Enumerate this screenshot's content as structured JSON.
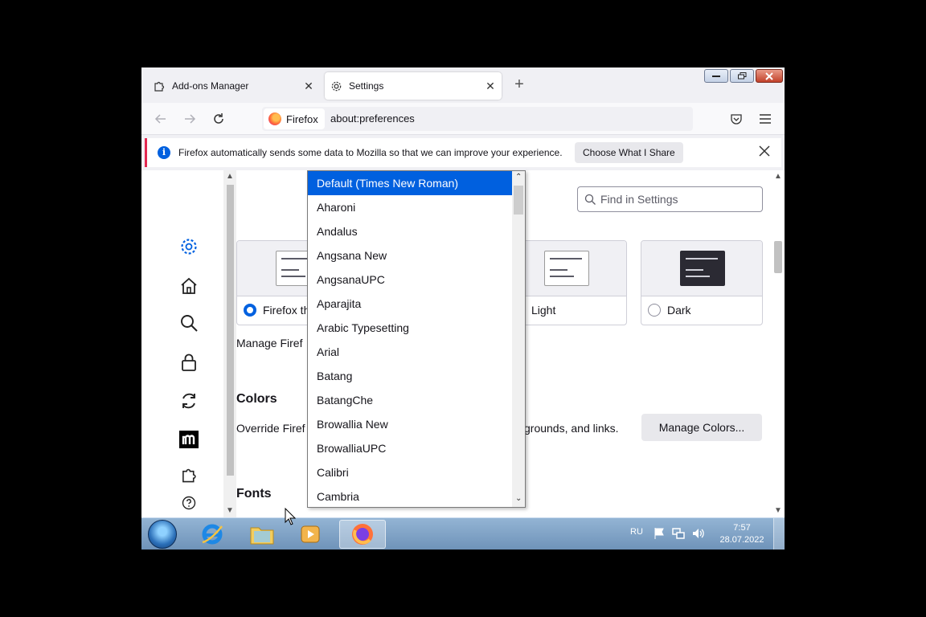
{
  "tabs": [
    {
      "title": "Add-ons Manager",
      "icon": "puzzle-icon"
    },
    {
      "title": "Settings",
      "icon": "gear-icon"
    }
  ],
  "navbar": {
    "identity_label": "Firefox",
    "url": "about:preferences"
  },
  "notification": {
    "text": "Firefox automatically sends some data to Mozilla so that we can improve your experience.",
    "button_label": "Choose What I Share"
  },
  "sidebar": {
    "categories": [
      "gear-icon",
      "home-icon",
      "search-icon",
      "lock-icon",
      "sync-icon",
      "mozilla-m-icon",
      "puzzle-icon",
      "help-icon"
    ]
  },
  "settings": {
    "search_placeholder": "Find in Settings",
    "themes": [
      {
        "label": "Firefox th",
        "checked": true
      },
      {
        "label": "Light",
        "checked": false
      },
      {
        "label": "Dark",
        "checked": false
      }
    ],
    "manage_text": "Manage Firef",
    "colors_heading": "Colors",
    "colors_desc_left": "Override Firef",
    "colors_desc_right": "grounds, and links.",
    "manage_colors_label": "Manage Colors...",
    "fonts_heading": "Fonts"
  },
  "font_dropdown": {
    "selected": "Default (Times New Roman)",
    "options": [
      "Default (Times New Roman)",
      "Aharoni",
      "Andalus",
      "Angsana New",
      "AngsanaUPC",
      "Aparajita",
      "Arabic Typesetting",
      "Arial",
      "Batang",
      "BatangChe",
      "Browallia New",
      "BrowalliaUPC",
      "Calibri",
      "Cambria"
    ]
  },
  "taskbar": {
    "language": "RU",
    "time": "7:57",
    "date": "28.07.2022"
  },
  "colors": {
    "accent": "#0060df",
    "notification_border": "#e22850"
  }
}
